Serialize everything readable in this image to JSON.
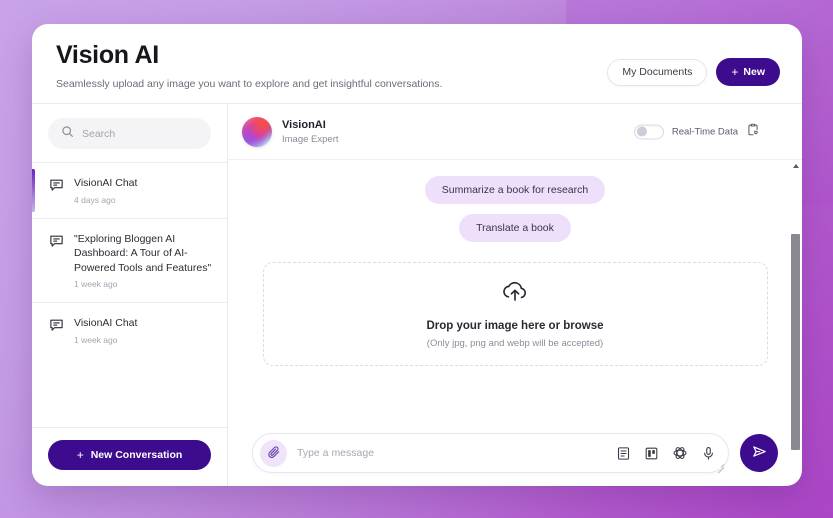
{
  "header": {
    "title": "Vision AI",
    "subtitle": "Seamlessly upload any image you want to explore and get insightful conversations.",
    "my_documents_label": "My Documents",
    "new_label": "New",
    "new_plus": "+"
  },
  "sidebar": {
    "search_placeholder": "Search",
    "search_value": "",
    "conversations": [
      {
        "title": "VisionAI Chat",
        "time": "4 days ago",
        "active": true
      },
      {
        "title": "\"Exploring Bloggen AI Dashboard: A Tour of AI-Powered Tools and Features\"",
        "time": "1 week ago",
        "active": false
      },
      {
        "title": "VisionAI Chat",
        "time": "1 week ago",
        "active": false
      }
    ],
    "new_conversation_label": "New Conversation",
    "new_conversation_plus": "+"
  },
  "chat": {
    "agent_name": "VisionAI",
    "agent_role": "Image Expert",
    "realtime_label": "Real-Time Data",
    "realtime_enabled": false,
    "suggestions": [
      "Summarize a book for research",
      "Translate a book"
    ],
    "dropzone": {
      "title": "Drop your image here or browse",
      "subtitle": "(Only jpg, png and webp will be accepted)"
    },
    "composer": {
      "placeholder": "Type a message",
      "value": ""
    }
  },
  "colors": {
    "brand_purple": "#3d0b8e",
    "chip_background": "#eee0fb",
    "accent_bar": "#6a22c4",
    "page_gradient_start": "#c9a3e8",
    "page_gradient_end": "#ab45c6"
  }
}
